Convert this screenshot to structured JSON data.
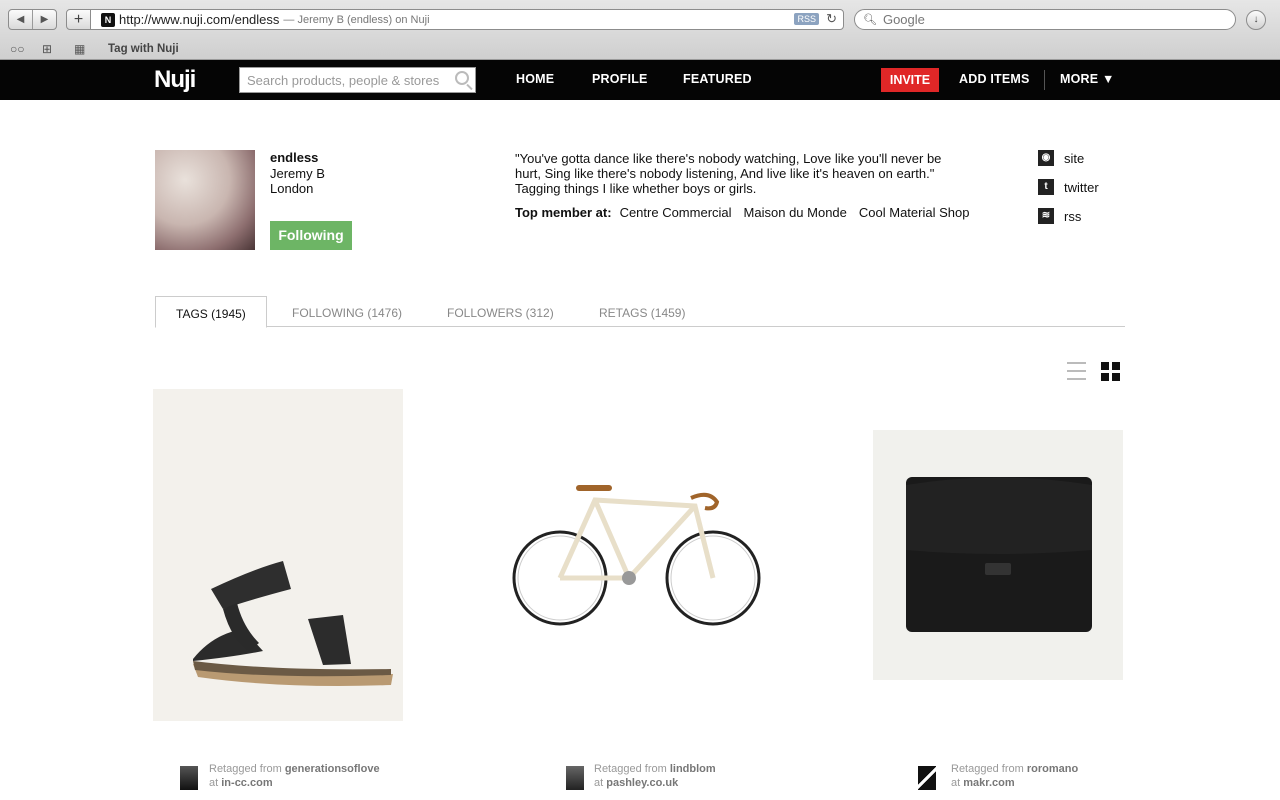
{
  "browser": {
    "favicon": "N",
    "url": "http://www.nuji.com/endless",
    "page_title": "— Jeremy B (endless) on Nuji",
    "rss_badge": "RSS",
    "search_placeholder": "Google",
    "bookmark_label": "Tag with Nuji"
  },
  "header": {
    "logo": "Nuji",
    "search_placeholder": "Search products, people & stores",
    "nav": [
      "HOME",
      "PROFILE",
      "FEATURED"
    ],
    "invite": "INVITE",
    "add_items": "ADD ITEMS",
    "more": "MORE ▼"
  },
  "profile": {
    "username": "endless",
    "real_name": "Jeremy B",
    "location": "London",
    "follow_state": "Following",
    "bio": "\"You've gotta dance like there's nobody watching, Love like you'll never be hurt, Sing like there's nobody listening, And live like it's heaven on earth.\" Tagging things I like whether boys or girls.",
    "top_member_label": "Top member at:",
    "top_member_stores": [
      "Centre Commercial",
      "Maison du Monde",
      "Cool Material Shop"
    ],
    "links": [
      {
        "icon": "globe-icon",
        "label": "site"
      },
      {
        "icon": "twitter-icon",
        "label": "twitter"
      },
      {
        "icon": "rss-icon",
        "label": "rss"
      }
    ]
  },
  "tabs": [
    {
      "label": "TAGS (1945)",
      "active": true
    },
    {
      "label": "FOLLOWING (1476)",
      "active": false
    },
    {
      "label": "FOLLOWERS (312)",
      "active": false
    },
    {
      "label": "RETAGS (1459)",
      "active": false
    }
  ],
  "items": [
    {
      "image": "sandal",
      "retag_prefix": "Retagged from",
      "retag_user": "generationsoflove",
      "at_prefix": "at",
      "store": "in-cc.com"
    },
    {
      "image": "bicycle",
      "retag_prefix": "Retagged from",
      "retag_user": "lindblom",
      "at_prefix": "at",
      "store": "pashley.co.uk"
    },
    {
      "image": "leather-case",
      "retag_prefix": "Retagged from",
      "retag_user": "roromano",
      "at_prefix": "at",
      "store": "makr.com"
    }
  ],
  "colors": {
    "header_bg": "#050505",
    "invite_bg": "#e02727",
    "following_bg": "#6db565"
  }
}
